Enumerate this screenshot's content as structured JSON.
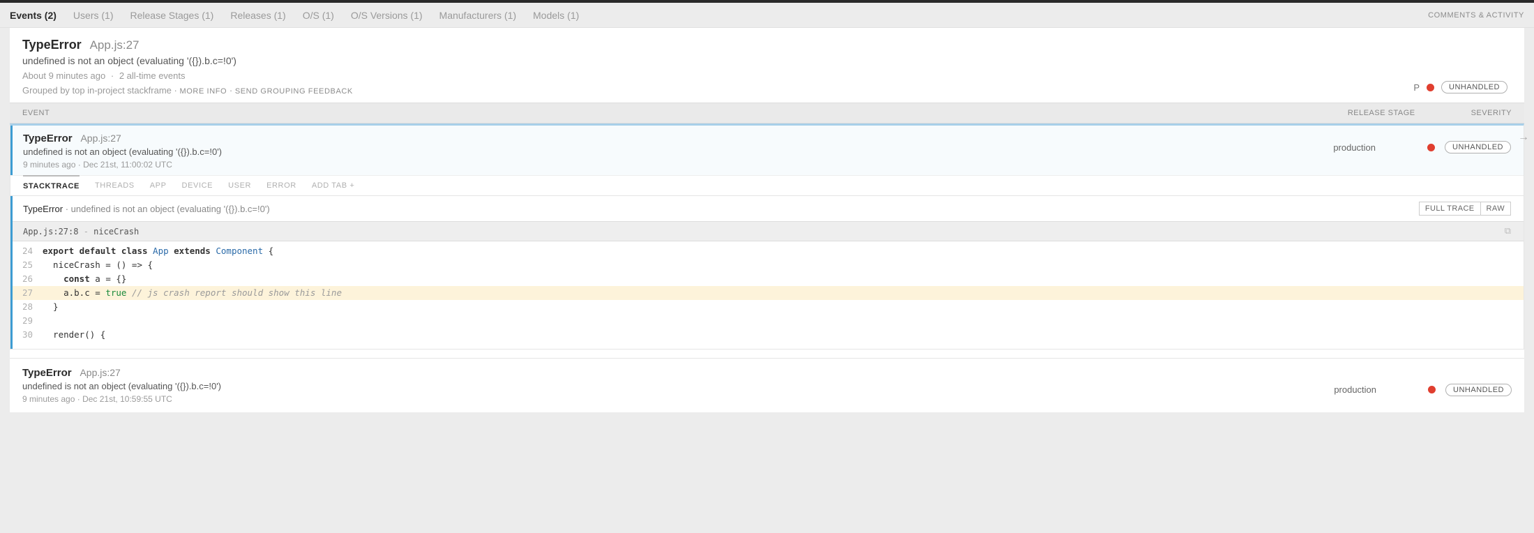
{
  "nav": {
    "tabs": [
      {
        "label": "Events (2)",
        "active": true
      },
      {
        "label": "Users (1)"
      },
      {
        "label": "Release Stages (1)"
      },
      {
        "label": "Releases (1)"
      },
      {
        "label": "O/S (1)"
      },
      {
        "label": "O/S Versions (1)"
      },
      {
        "label": "Manufacturers (1)"
      },
      {
        "label": "Models (1)"
      }
    ],
    "comments_label": "COMMENTS & ACTIVITY"
  },
  "header": {
    "title": "TypeError",
    "loc": "App.js:27",
    "msg": "undefined is not an object (evaluating '({}).b.c=!0')",
    "meta_time": "About 9 minutes ago",
    "meta_count": "2 all-time events",
    "group_text": "Grouped by top in-project stackframe",
    "more_info": "MORE INFO",
    "send_feedback": "SEND GROUPING FEEDBACK",
    "p_letter": "P",
    "unhandled": "UNHANDLED"
  },
  "cols": {
    "event": "EVENT",
    "stage": "RELEASE STAGE",
    "severity": "SEVERITY"
  },
  "events": [
    {
      "title": "TypeError",
      "loc": "App.js:27",
      "msg": "undefined is not an object (evaluating '({}).b.c=!0')",
      "meta_time": "9 minutes ago",
      "meta_ts": "Dec 21st, 11:00:02 UTC",
      "stage": "production",
      "unhandled": "UNHANDLED"
    },
    {
      "title": "TypeError",
      "loc": "App.js:27",
      "msg": "undefined is not an object (evaluating '({}).b.c=!0')",
      "meta_time": "9 minutes ago",
      "meta_ts": "Dec 21st, 10:59:55 UTC",
      "stage": "production",
      "unhandled": "UNHANDLED"
    }
  ],
  "ev_tabs": [
    {
      "label": "STACKTRACE",
      "active": true
    },
    {
      "label": "THREADS"
    },
    {
      "label": "APP"
    },
    {
      "label": "DEVICE"
    },
    {
      "label": "USER"
    },
    {
      "label": "ERROR"
    },
    {
      "label": "ADD TAB +"
    }
  ],
  "trace": {
    "type": "TypeError",
    "msg": "undefined is not an object (evaluating '({}).b.c=!0')",
    "full_btn": "FULL TRACE",
    "raw_btn": "RAW",
    "frame_loc_file": "App.js:27:8",
    "frame_loc_fn": "niceCrash",
    "code": [
      {
        "n": "24",
        "html": "<span class='kw'>export default class</span> <span class='cls'>App</span> <span class='kw'>extends</span> <span class='cls'>Component</span> {"
      },
      {
        "n": "25",
        "html": "  niceCrash = () =&gt; {"
      },
      {
        "n": "26",
        "html": "    <span class='kw'>const</span> a = {}"
      },
      {
        "n": "27",
        "html": "    a.b.c = <span class='val'>true</span> <span class='cmt'>// js crash report should show this line</span>",
        "hl": true
      },
      {
        "n": "28",
        "html": "  }"
      },
      {
        "n": "29",
        "html": ""
      },
      {
        "n": "30",
        "html": "  render() {"
      }
    ]
  }
}
